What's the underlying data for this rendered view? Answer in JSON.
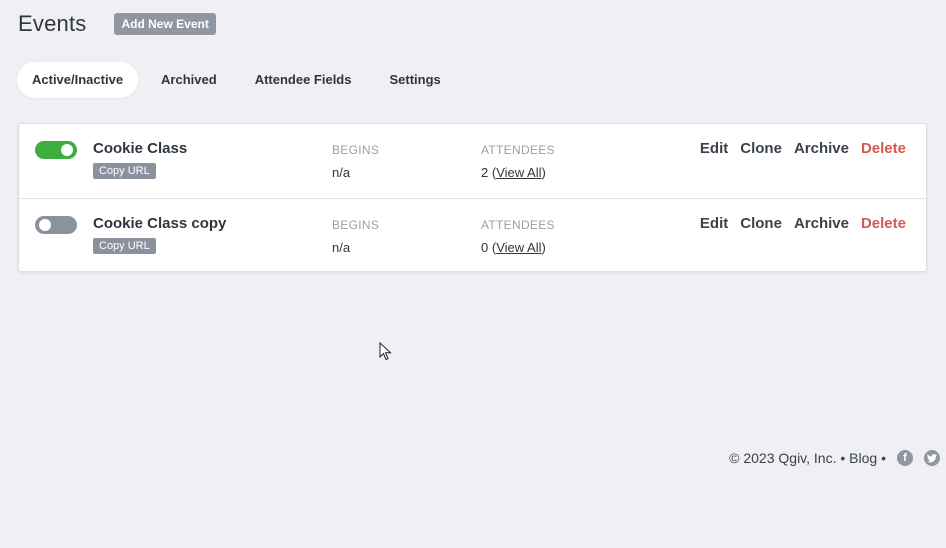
{
  "header": {
    "title": "Events",
    "add_button": "Add New Event"
  },
  "tabs": [
    {
      "label": "Active/Inactive",
      "active": true
    },
    {
      "label": "Archived",
      "active": false
    },
    {
      "label": "Attendee Fields",
      "active": false
    },
    {
      "label": "Settings",
      "active": false
    }
  ],
  "events": [
    {
      "name": "Cookie Class",
      "enabled": true,
      "copy_url": "Copy URL",
      "begins_label": "BEGINS",
      "begins_value": "n/a",
      "attendees_label": "ATTENDEES",
      "attendees_count": "2",
      "view_all": "View All",
      "actions": {
        "edit": "Edit",
        "clone": "Clone",
        "archive": "Archive",
        "delete": "Delete"
      }
    },
    {
      "name": "Cookie Class copy",
      "enabled": false,
      "copy_url": "Copy URL",
      "begins_label": "BEGINS",
      "begins_value": "n/a",
      "attendees_label": "ATTENDEES",
      "attendees_count": "0",
      "view_all": "View All",
      "actions": {
        "edit": "Edit",
        "clone": "Clone",
        "archive": "Archive",
        "delete": "Delete"
      }
    }
  ],
  "footer": {
    "copyright": "© 2023 Qgiv, Inc. •",
    "blog": "Blog",
    "separator": "•",
    "icons": [
      "facebook-icon",
      "twitter-icon"
    ]
  },
  "colors": {
    "background": "#efeff4",
    "toggle_on": "#3dae3d",
    "toggle_off": "#8a939d",
    "delete": "#d15b52",
    "button_gray": "#9097a0"
  }
}
